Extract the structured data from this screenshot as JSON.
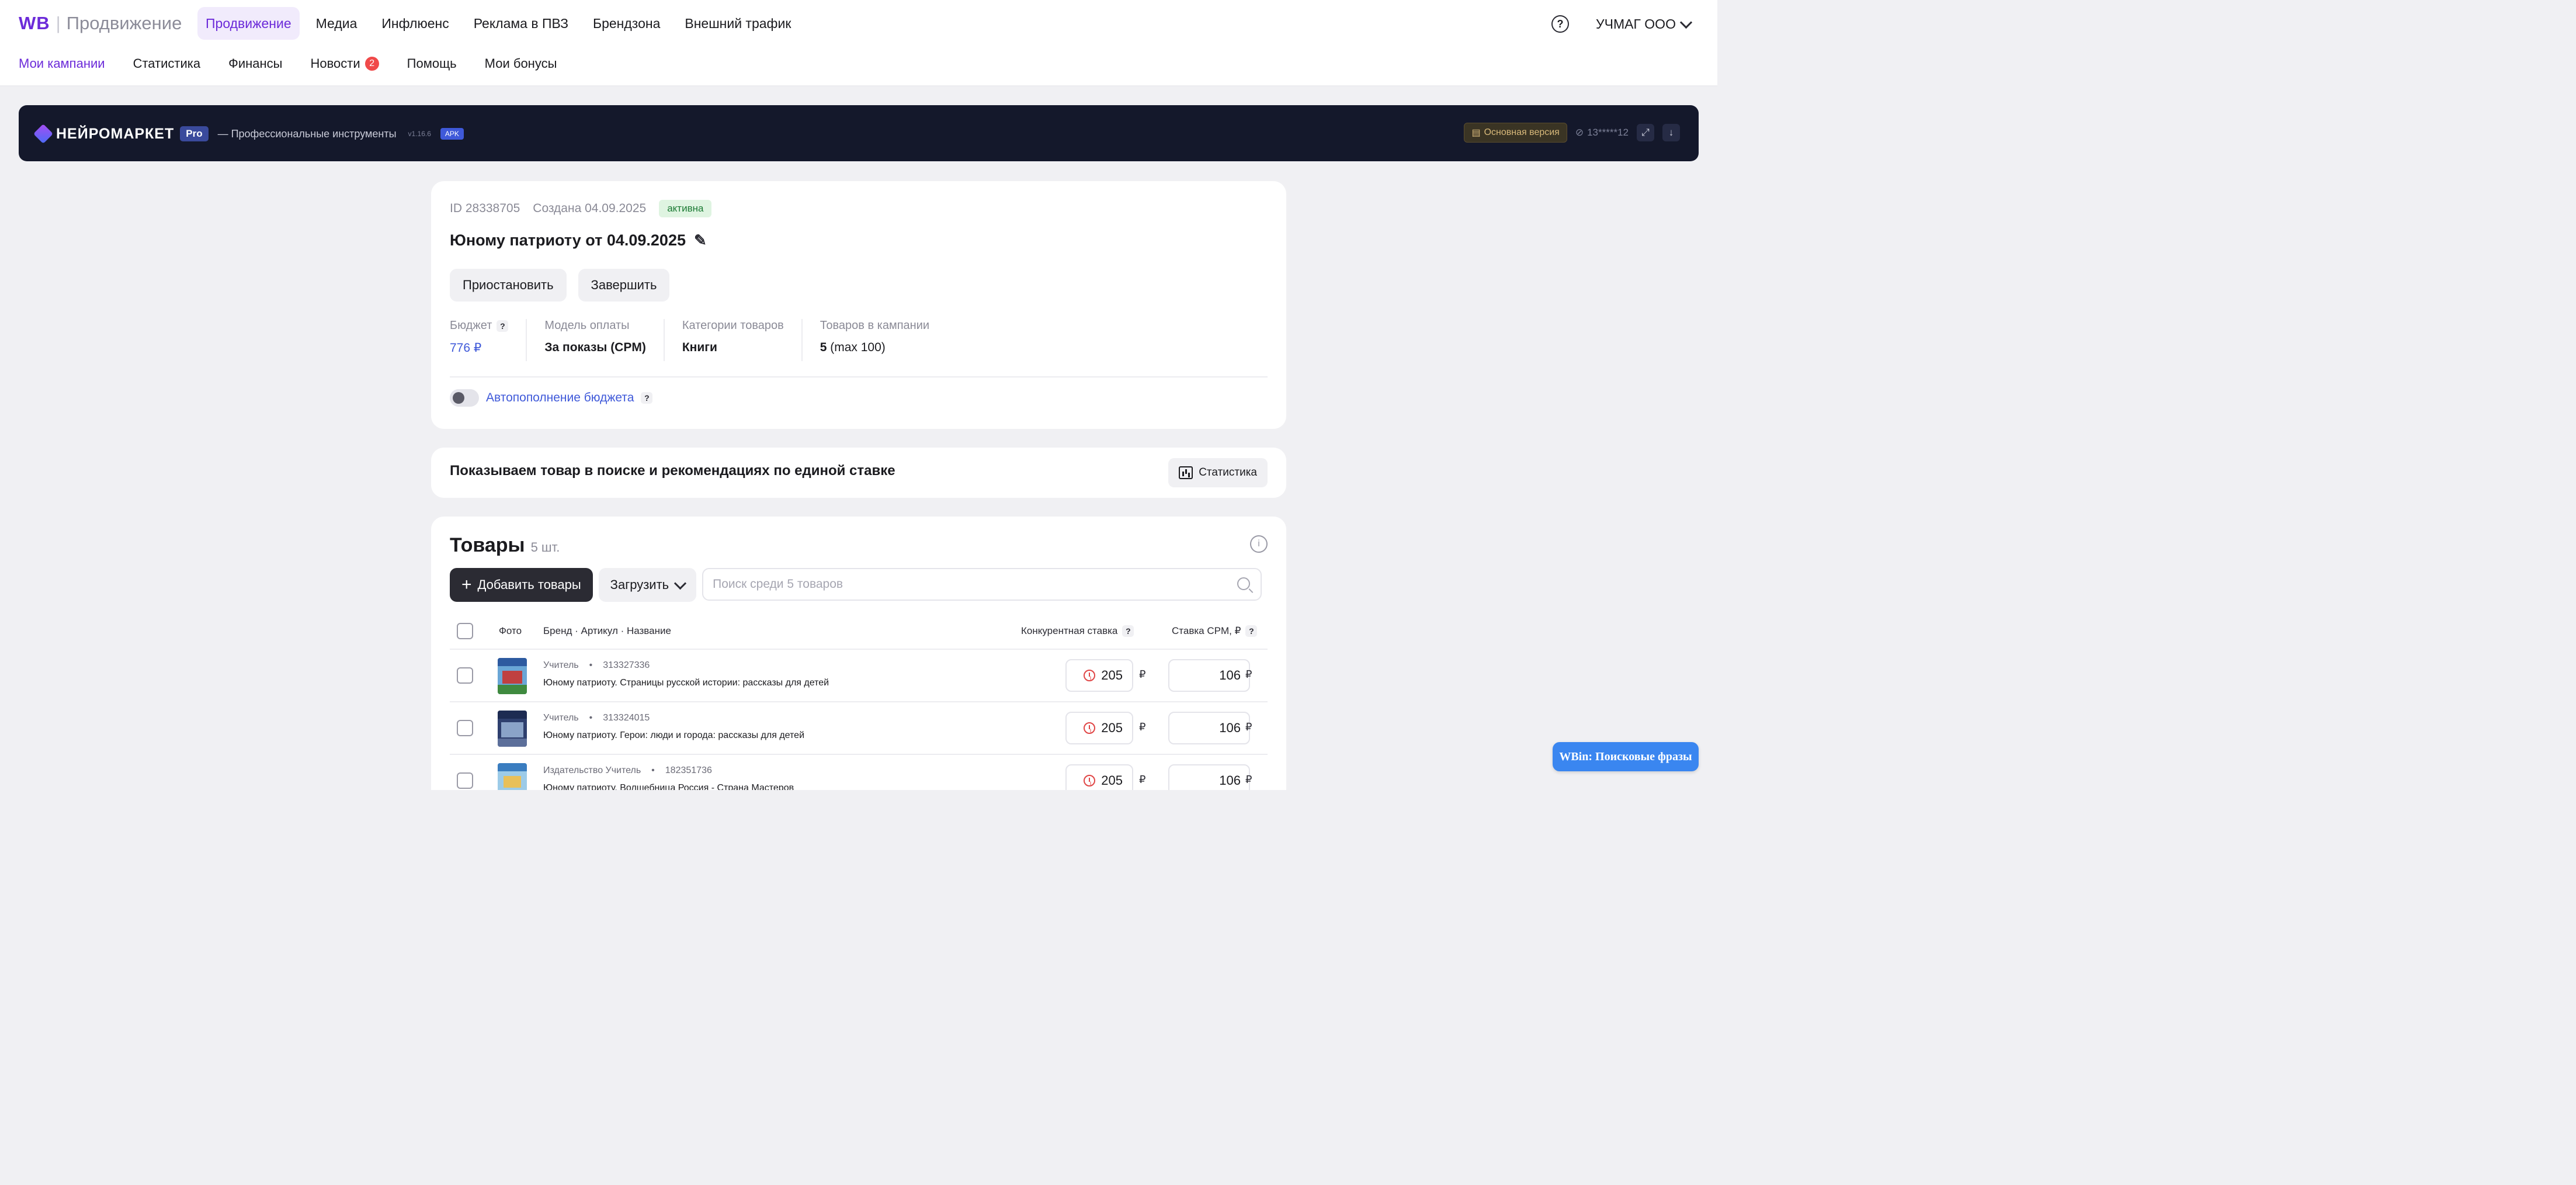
{
  "header": {
    "logo": "WB",
    "logo_suffix": "Продвижение",
    "main_tabs": [
      {
        "label": "Продвижение",
        "active": true
      },
      {
        "label": "Медиа"
      },
      {
        "label": "Инфлюенс"
      },
      {
        "label": "Реклама в ПВЗ"
      },
      {
        "label": "Брендзона"
      },
      {
        "label": "Внешний трафик"
      }
    ],
    "help_icon": "?",
    "account_name": "УЧМАГ ООО",
    "sub_tabs": [
      {
        "label": "Мои кампании",
        "active": true
      },
      {
        "label": "Статистика"
      },
      {
        "label": "Финансы"
      },
      {
        "label": "Новости",
        "badge": "2"
      },
      {
        "label": "Помощь"
      },
      {
        "label": "Мои бонусы"
      }
    ]
  },
  "banner": {
    "brand": "НЕЙРОМАРКЕТ",
    "pro": "Pro",
    "description": "— Профессиональные инструменты",
    "version": "v1.16.6",
    "apk": "APK",
    "main_version": "Основная версия",
    "masked_id": "13*****12"
  },
  "campaign": {
    "id": "ID 28338705",
    "created": "Создана 04.09.2025",
    "status": "активна",
    "title": "Юному патриоту от 04.09.2025",
    "pause_label": "Приостановить",
    "finish_label": "Завершить",
    "budget_label": "Бюджет",
    "budget_value": "776 ₽",
    "payment_label": "Модель оплаты",
    "payment_value": "За показы (CPM)",
    "category_label": "Категории товаров",
    "category_value": "Книги",
    "items_label": "Товаров в кампании",
    "items_value": "5",
    "items_max": "(max 100)",
    "autofill_label": "Автопополнение бюджета",
    "autofill_enabled": false
  },
  "strategy": {
    "text": "Показываем товар в поиске и рекомендациях по единой ставке",
    "stats_button": "Статистика"
  },
  "products": {
    "title": "Товары",
    "count": "5 шт.",
    "add_button": "Добавить товары",
    "load_button": "Загрузить",
    "search_placeholder": "Поиск среди 5 товаров",
    "columns": {
      "photo": "Фото",
      "brand": "Бренд · Артикул · Название",
      "competitive": "Конкурентная ставка",
      "cpm": "Ставка CPM, ₽"
    },
    "rows": [
      {
        "brand": "Учитель",
        "sku": "313327336",
        "name": "Юному патриоту. Страницы русской истории: рассказы для детей",
        "competitive_bid": "205",
        "cpm": "106",
        "currency": "₽"
      },
      {
        "brand": "Учитель",
        "sku": "313324015",
        "name": "Юному патриоту. Герои: люди и города: рассказы для детей",
        "competitive_bid": "205",
        "cpm": "106",
        "currency": "₽"
      },
      {
        "brand": "Издательство Учитель",
        "sku": "182351736",
        "name": "Юному патриоту. Волшебница Россия - Страна Мастеров",
        "competitive_bid": "205",
        "cpm": "106",
        "currency": "₽"
      }
    ]
  },
  "floating": {
    "label": "WBin: Поисковые фразы"
  },
  "colors": {
    "accent": "#6c2bd9",
    "link": "#3f59d9",
    "banner_bg": "#14182b",
    "float_button": "#3a86f0",
    "status_bg": "#dff4e1"
  }
}
